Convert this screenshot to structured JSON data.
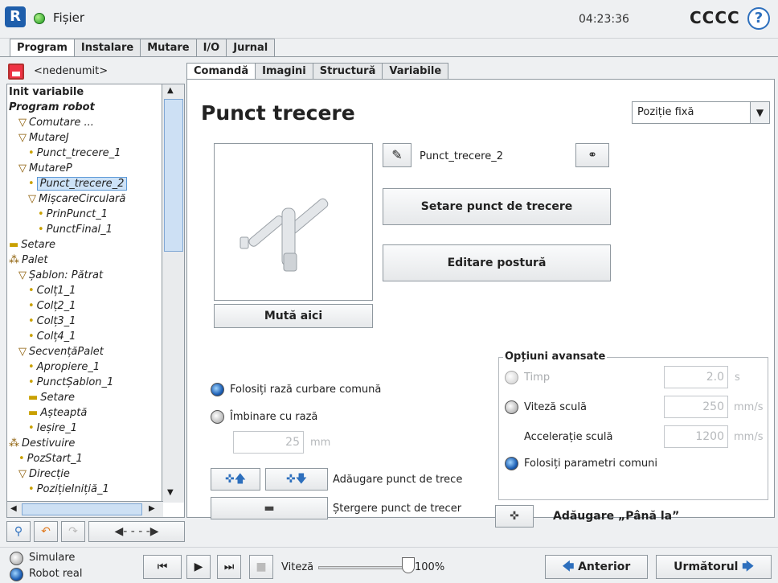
{
  "header": {
    "file_menu": "Fișier",
    "time": "04:23:36",
    "robot_name": "CCCC",
    "help_label": "?"
  },
  "tabs": [
    "Program",
    "Instalare",
    "Mutare",
    "I/O",
    "Jurnal"
  ],
  "file_name": "<nedenumit>",
  "subtabs": [
    "Comandă",
    "Imagini",
    "Structură",
    "Variabile"
  ],
  "tree": [
    {
      "t": "Init variabile",
      "b": true,
      "i": ""
    },
    {
      "t": "Program robot",
      "b": true,
      "it": true,
      "i": ""
    },
    {
      "t": "Comutare ...",
      "i": "▽",
      "d": 1
    },
    {
      "t": "MutareJ",
      "i": "▽",
      "d": 1
    },
    {
      "t": "Punct_trecere_1",
      "i": "•",
      "d": 2
    },
    {
      "t": "MutareP",
      "i": "▽",
      "d": 1
    },
    {
      "t": "Punct_trecere_2",
      "i": "•",
      "d": 2,
      "sel": true
    },
    {
      "t": "MișcareCirculară",
      "i": "▽",
      "d": 2
    },
    {
      "t": "PrinPunct_1",
      "i": "•",
      "d": 3
    },
    {
      "t": "PunctFinal_1",
      "i": "•",
      "d": 3
    },
    {
      "t": "Setare",
      "i": "▬",
      "d": 0
    },
    {
      "t": "Palet",
      "i": "⁂",
      "d": 0
    },
    {
      "t": "Șablon: Pătrat",
      "i": "▽",
      "d": 1
    },
    {
      "t": "Colț1_1",
      "i": "•",
      "d": 2
    },
    {
      "t": "Colț2_1",
      "i": "•",
      "d": 2
    },
    {
      "t": "Colț3_1",
      "i": "•",
      "d": 2
    },
    {
      "t": "Colț4_1",
      "i": "•",
      "d": 2
    },
    {
      "t": "SecvențăPalet",
      "i": "▽",
      "d": 1
    },
    {
      "t": "Apropiere_1",
      "i": "•",
      "d": 2
    },
    {
      "t": "PunctȘablon_1",
      "i": "•",
      "d": 2
    },
    {
      "t": "Setare",
      "i": "▬",
      "d": 2
    },
    {
      "t": "Așteaptă",
      "i": "▬",
      "d": 2
    },
    {
      "t": "Ieșire_1",
      "i": "•",
      "d": 2
    },
    {
      "t": "Destivuire",
      "i": "⁂",
      "d": 0
    },
    {
      "t": "PozStart_1",
      "i": "•",
      "d": 1
    },
    {
      "t": "Direcție",
      "i": "▽",
      "d": 1
    },
    {
      "t": "PozițieInițiă_1",
      "i": "•",
      "d": 2
    }
  ],
  "main": {
    "title": "Punct trecere",
    "mode_select": "Poziție fixă",
    "waypoint_name": "Punct_trecere_2",
    "move_here": "Mută aici",
    "set_waypoint": "Setare punct de trecere",
    "edit_pose": "Editare postură",
    "use_shared_blend": "Folosiți rază curbare comună",
    "blend_with_radius": "Îmbinare cu rază",
    "blend_value": "25",
    "blend_unit": "mm",
    "add_waypoint": "Adăugare punct de trece",
    "delete_waypoint": "Ștergere punct de trecer",
    "advanced_title": "Opțiuni avansate",
    "time_label": "Timp",
    "time_value": "2.0",
    "time_unit": "s",
    "tool_speed": "Viteză sculă",
    "tool_speed_value": "250",
    "tool_speed_unit": "mm/s",
    "tool_acc": "Accelerație sculă",
    "tool_acc_value": "1200",
    "tool_acc_unit": "mm/s",
    "shared_params": "Folosiți parametri comuni",
    "add_until": "Adăugare „Până la”"
  },
  "footer": {
    "simulation": "Simulare",
    "real_robot": "Robot real",
    "speed_label": "Viteză",
    "speed_value": "100%",
    "prev": "Anterior",
    "next": "Următorul"
  }
}
